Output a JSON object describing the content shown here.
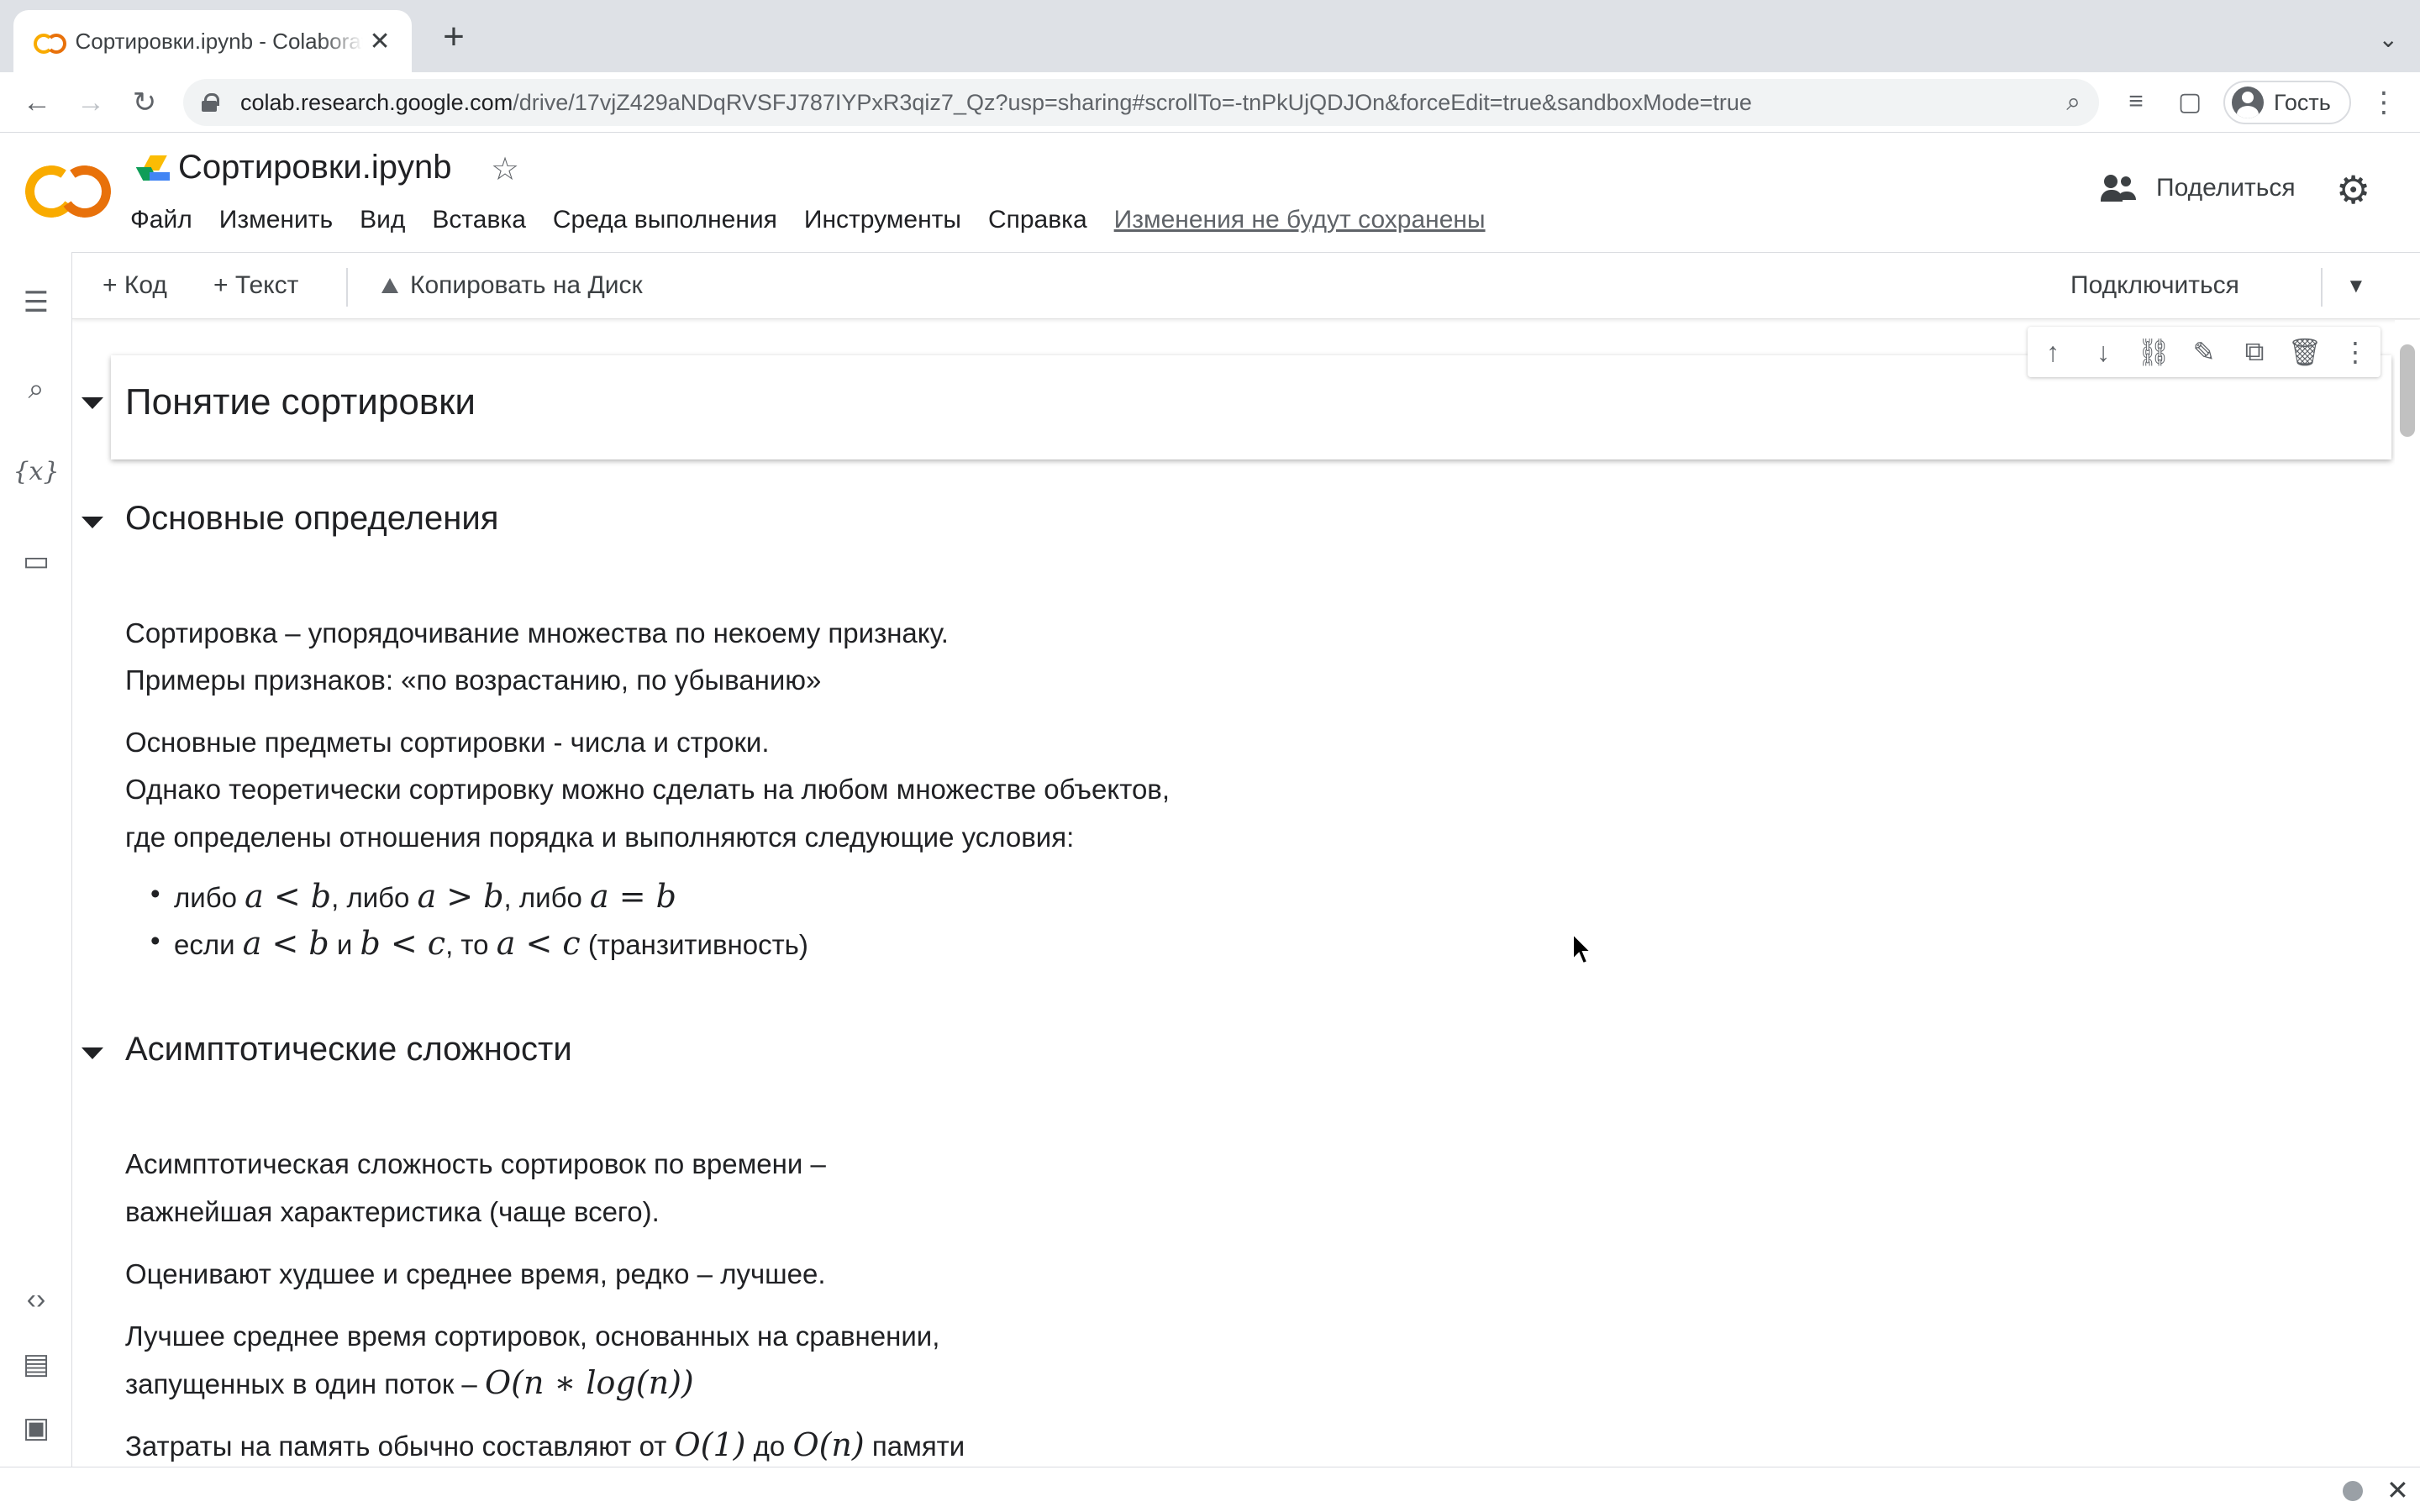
{
  "browser": {
    "tab_title": "Сортировки.ipynb - Colaboratory",
    "tab_close": "✕",
    "new_tab": "+",
    "url_host": "colab.research.google.com",
    "url_path": "/drive/17vjZ429aNDqRVSFJ787IYPxR3qiz7_Qz?usp=sharing#scrollTo=-tnPkUjQDJOn&forceEdit=true&sandboxMode=true",
    "profile_name": "Гость"
  },
  "colab": {
    "notebook_title": "Сортировки.ipynb",
    "menu": [
      "Файл",
      "Изменить",
      "Вид",
      "Вставка",
      "Среда выполнения",
      "Инструменты",
      "Справка"
    ],
    "unsaved_notice": "Изменения не будут сохранены",
    "share_label": "Поделиться",
    "toolbar": {
      "add_code": "+ Код",
      "add_text": "+ Текст",
      "copy_to_drive": "Копировать на Диск",
      "connect": "Подключиться"
    }
  },
  "notebook": {
    "h1": "Понятие сортировки",
    "sec1_title": "Основные определения",
    "sec1_p1_l1": "Сортировка – упорядочивание множества по некоему признаку.",
    "sec1_p1_l2": "Примеры признаков: «по возрастанию, по убыванию»",
    "sec1_p2_l1": "Основные предметы сортировки - числа и строки.",
    "sec1_p2_l2": "Однако теоретически сортировку можно сделать на любом множестве объектов,",
    "sec1_p2_l3": "где определены отношения порядка и выполняются следующие условия:",
    "b1_w1": "либо",
    "b1_m1": "a < b",
    "b1_w2": ", либо",
    "b1_m2": "a > b",
    "b1_w3": ", либо",
    "b1_m3": "a = b",
    "b2_w1": "если",
    "b2_m1": "a < b",
    "b2_w2": "и",
    "b2_m2": "b < c",
    "b2_w3": ", то",
    "b2_m3": "a < c",
    "b2_w4": "(транзитивность)",
    "sec2_title": "Асимптотические сложности",
    "sec2_p1_l1": "Асимптотическая сложность сортировок по времени –",
    "sec2_p1_l2": "важнейшая характеристика (чаще всего).",
    "sec2_p2": "Оценивают худшее и среднее время, редко – лучшее.",
    "sec2_p3_l1": "Лучшее среднее время сортировок, основанных на сравнении,",
    "sec2_p3_l2": "запущенных в один поток –",
    "sec2_p3_math": "O(n ∗ log(n))",
    "sec2_p4_w1": "Затраты на память обычно составляют от",
    "sec2_p4_m1": "O(1)",
    "sec2_p4_w2": "до",
    "sec2_p4_m2": "O(n)",
    "sec2_p4_w3": "памяти"
  },
  "icons": {
    "back": "back-arrow-icon",
    "forward": "forward-arrow-icon",
    "reload": "reload-icon",
    "zoom": "zoom-icon",
    "reading_list": "reading-list-icon",
    "side_panel": "side-panel-icon",
    "cell_actions": [
      "arrow-up-icon",
      "arrow-down-icon",
      "link-icon",
      "edit-icon",
      "mirror-cell-icon",
      "delete-icon",
      "more-icon"
    ]
  },
  "colors": {
    "accent_orange": "#f9ab00",
    "accent_dark_orange": "#e8710a",
    "text": "#202124",
    "muted": "#5f6368"
  }
}
